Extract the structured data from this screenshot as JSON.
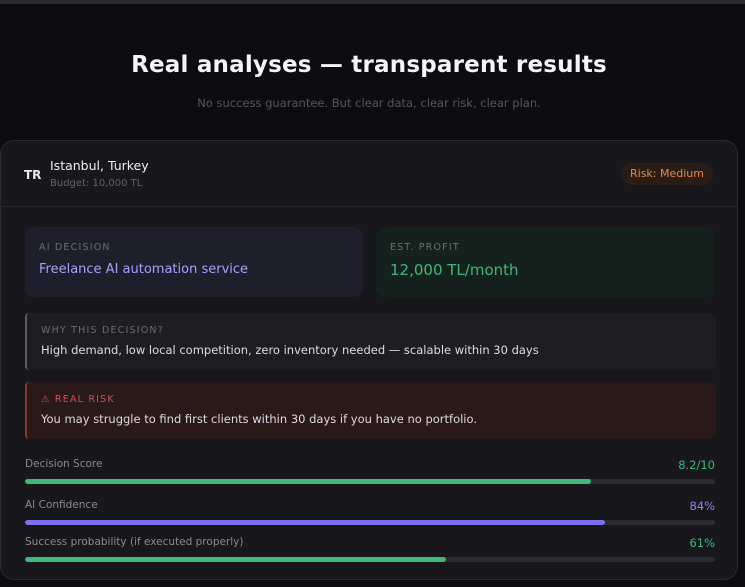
{
  "header": {
    "title": "Real analyses — transparent results",
    "subtitle": "No success guarantee. But clear data, clear risk, clear plan."
  },
  "card": {
    "country_code": "TR",
    "location": "Istanbul, Turkey",
    "budget": "Budget: 10,000 TL",
    "risk_badge": "Risk: Medium",
    "ai_decision_label": "AI DECISION",
    "ai_decision_value": "Freelance AI automation service",
    "est_profit_label": "EST. PROFIT",
    "est_profit_value": "12,000 TL/month",
    "why_label": "WHY THIS DECISION?",
    "why_text": "High demand, low local competition, zero inventory needed — scalable within 30 days",
    "risk_label": "⚠ REAL RISK",
    "risk_text": "You may struggle to find first clients within 30 days if you have no portfolio."
  },
  "metrics": [
    {
      "label": "Decision Score",
      "value": "8.2/10",
      "fraction": 0.82,
      "color": "#3fb97b"
    },
    {
      "label": "AI Confidence",
      "value": "84%",
      "fraction": 0.84,
      "color": "#7d6ff0"
    },
    {
      "label": "Success probability (if executed properly)",
      "value": "61%",
      "fraction": 0.61,
      "color": "#3fb97b"
    }
  ]
}
